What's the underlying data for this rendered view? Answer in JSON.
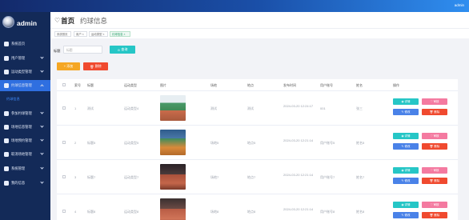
{
  "topbar": {
    "user": "admin",
    "bg_colors": [
      "#132a6b",
      "#2f8ef0"
    ]
  },
  "sidebar": {
    "brand": "admin",
    "items": [
      {
        "label": "系统首页",
        "icon": "home-icon",
        "has_arrow": false,
        "active": false
      },
      {
        "label": "用户管理",
        "icon": "user-icon",
        "has_arrow": true,
        "active": false
      },
      {
        "label": "运动类型管理",
        "icon": "grid-icon",
        "has_arrow": true,
        "active": false
      },
      {
        "label": "约球信息管理",
        "icon": "ball-icon",
        "has_arrow": true,
        "active": true
      },
      {
        "label": "参加约球管理",
        "icon": "join-icon",
        "has_arrow": true,
        "active": false
      },
      {
        "label": "场地信息管理",
        "icon": "venue-icon",
        "has_arrow": true,
        "active": false
      },
      {
        "label": "场地预约管理",
        "icon": "calendar-icon",
        "has_arrow": true,
        "active": false
      },
      {
        "label": "取消场地管理",
        "icon": "cancel-icon",
        "has_arrow": true,
        "active": false
      },
      {
        "label": "系统管理",
        "icon": "settings-icon",
        "has_arrow": true,
        "active": false
      },
      {
        "label": "我的信息",
        "icon": "profile-icon",
        "has_arrow": true,
        "active": false
      }
    ],
    "submenu_label": "约球信息",
    "accent": "#2f6fe0"
  },
  "header": {
    "home": "首页",
    "title": "约球信息"
  },
  "tabs": [
    {
      "label": "系统首页",
      "active": false
    },
    {
      "label": "用户 ×",
      "active": false
    },
    {
      "label": "运动类型 ×",
      "active": false
    },
    {
      "label": "约球信息 ×",
      "active": true
    }
  ],
  "search": {
    "label": "标题",
    "placeholder": "标题",
    "query_button": "查询"
  },
  "actions": {
    "add": "+ 添加",
    "delete": "删除"
  },
  "table": {
    "headers": [
      "索号",
      "标题",
      "运动类型",
      "图片",
      "场地",
      "地点",
      "发布时间",
      "用户账号",
      "姓名",
      "操作"
    ],
    "rows": [
      {
        "index": "1",
        "title": "测试",
        "type": "运动类型4",
        "venue": "测试",
        "place": "测试",
        "time": "2024-03-20 12:24:17",
        "account": "001",
        "name": "张三",
        "image": "court-photo-1"
      },
      {
        "index": "2",
        "title": "标题5",
        "type": "运动类型5",
        "venue": "场地5",
        "place": "地点5",
        "time": "2024-03-20 12:21:14",
        "account": "用户账号5",
        "name": "姓名5",
        "image": "court-photo-2"
      },
      {
        "index": "3",
        "title": "标题7",
        "type": "运动类型7",
        "venue": "场地7",
        "place": "地点7",
        "time": "2024-03-20 12:21:14",
        "account": "用户账号7",
        "name": "姓名7",
        "image": "court-photo-3"
      },
      {
        "index": "4",
        "title": "标题8",
        "type": "运动类型8",
        "venue": "场地8",
        "place": "地点8",
        "time": "2024-03-20 12:21:14",
        "account": "用户账号8",
        "name": "姓名8",
        "image": "court-photo-4"
      }
    ],
    "row_actions": {
      "detail": "◉ 详情",
      "review": "♡ 审核",
      "edit": "✎ 修改",
      "remove": "🗑 删除"
    }
  }
}
